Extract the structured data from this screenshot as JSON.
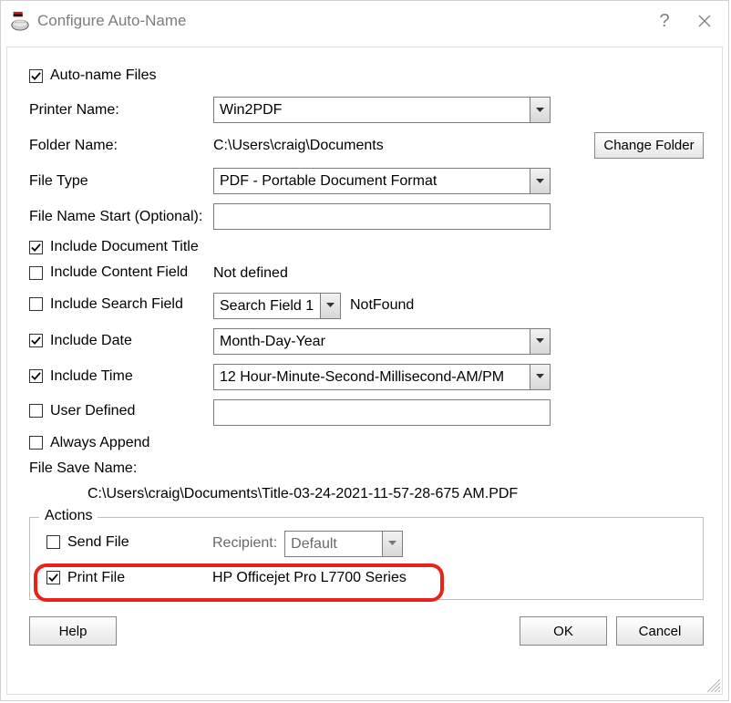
{
  "titlebar": {
    "title": "Configure Auto-Name",
    "help": "?"
  },
  "rows": {
    "autoName": {
      "label": "Auto-name Files",
      "checked": true
    },
    "printerName": {
      "label": "Printer Name:",
      "value": "Win2PDF"
    },
    "folderName": {
      "label": "Folder Name:",
      "value": "C:\\Users\\craig\\Documents",
      "button": "Change Folder"
    },
    "fileType": {
      "label": "File Type",
      "value": "PDF - Portable Document Format"
    },
    "fileNameStart": {
      "label": "File Name Start (Optional):",
      "value": ""
    },
    "includeTitle": {
      "label": "Include Document Title",
      "checked": true
    },
    "includeContent": {
      "label": "Include Content Field",
      "checked": false,
      "value": "Not defined"
    },
    "includeSearch": {
      "label": "Include Search Field",
      "checked": false,
      "combo": "Search Field 1",
      "status": "NotFound"
    },
    "includeDate": {
      "label": "Include Date",
      "checked": true,
      "combo": "Month-Day-Year"
    },
    "includeTime": {
      "label": "Include Time",
      "checked": true,
      "combo": "12 Hour-Minute-Second-Millisecond-AM/PM"
    },
    "userDefined": {
      "label": "User Defined",
      "checked": false,
      "value": ""
    },
    "alwaysAppend": {
      "label": "Always Append",
      "checked": false
    },
    "fileSaveName": {
      "label": "File Save Name:",
      "value": "C:\\Users\\craig\\Documents\\Title-03-24-2021-11-57-28-675 AM.PDF"
    }
  },
  "actions": {
    "legend": "Actions",
    "sendFile": {
      "label": "Send File",
      "checked": false,
      "recipientLabel": "Recipient:",
      "recipient": "Default"
    },
    "printFile": {
      "label": "Print File",
      "checked": true,
      "printer": "HP Officejet Pro L7700 Series"
    }
  },
  "footer": {
    "help": "Help",
    "ok": "OK",
    "cancel": "Cancel"
  }
}
